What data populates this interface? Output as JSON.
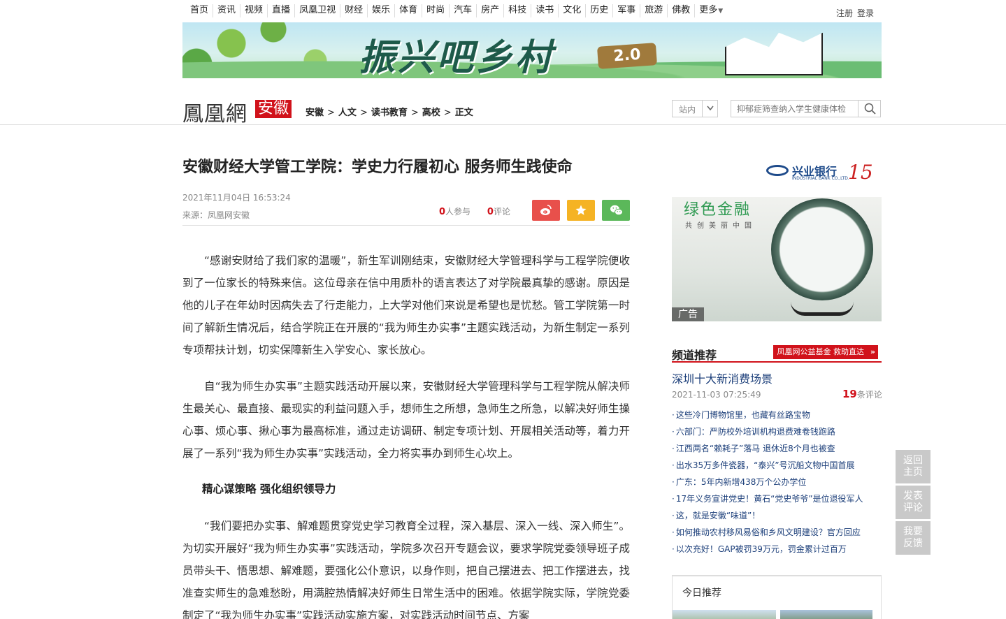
{
  "topnav": {
    "items": [
      "首页",
      "资讯",
      "视频",
      "直播",
      "凤凰卫视",
      "财经",
      "娱乐",
      "体育",
      "时尚",
      "汽车",
      "房产",
      "科技",
      "读书",
      "文化",
      "历史",
      "军事",
      "旅游",
      "佛教",
      "更多"
    ],
    "register": "注册",
    "login": "登录"
  },
  "banner": {
    "title": "振兴吧乡村",
    "version": "2.0"
  },
  "header": {
    "logo": "鳳凰網",
    "region": "安徽",
    "breadcrumb": [
      "安徽",
      "人文",
      "读书教育",
      "高校",
      "正文"
    ],
    "breadcrumb_sep": ">",
    "site_select": "站内",
    "search_placeholder": "抑郁症筛查纳入学生健康体检"
  },
  "article": {
    "title": "安徽财经大学管工学院：学史力行履初心 服务师生践使命",
    "datetime": "2021年11月04日 16:53:24",
    "source": "来源：凤凰网安徽",
    "participants_num": "0",
    "participants_label": "人参与",
    "comments_num": "0",
    "comments_label": "评论",
    "paragraphs": [
      "“感谢安财给了我们家的温暖”，新生军训刚结束，安徽财经大学管理科学与工程学院便收到了一位家长的特殊来信。这位母亲在信中用质朴的语言表达了对学院最真挚的感谢。原因是他的儿子在年幼时因病失去了行走能力，上大学对他们来说是希望也是忧愁。管工学院第一时间了解新生情况后，结合学院正在开展的“我为师生办实事”主题实践活动，为新生制定一系列专项帮扶计划，切实保障新生入学安心、家长放心。",
      "自“我为师生办实事”主题实践活动开展以来，安徽财经大学管理科学与工程学院从解决师生最关心、最直接、最现实的利益问题入手，想师生之所想，急师生之所急，以解决好师生操心事、烦心事、揪心事为最高标准，通过走访调研、制定专项计划、开展相关活动等，着力开展了一系列“我为师生办实事”实践活动，全力将实事办到师生心坎上。",
      "“我们要把办实事、解难题贯穿党史学习教育全过程，深入基层、深入一线、深入师生”。为切实开展好“我为师生办实事”实践活动，学院多次召开专题会议，要求学院党委领导班子成员带头干、悟思想、解难题，要强化公仆意识，以身作则，把自己摆进去、把工作摆进去，找准查实师生的急难愁盼，用满腔热情解决好师生日常生活中的困难。依据学院实际，学院党委制定了“我为师生办实事”实践活动实施方案，对实践活动时间节点、方案"
    ],
    "subheading": "精心谋策略 强化组织领导力"
  },
  "ad": {
    "bank_name": "兴业银行",
    "bank_sub": "INDUSTRIAL BANK CO.,LTD.",
    "anniversary": "15",
    "slogan": "绿色金融",
    "slogan_sub": "共创美丽中国",
    "tag": "广告"
  },
  "sidebar": {
    "channel_title": "频道推荐",
    "channel_link": "凤凰网公益基金  救助直达",
    "featured_title": "深圳十大新消费场景",
    "featured_date": "2021-11-03 07:25:49",
    "featured_comments_num": "19",
    "featured_comments_label": "条评论",
    "news": [
      "这些冷门博物馆里，也藏有丝路宝物",
      "六部门：严防校外培训机构退费难卷钱跑路",
      "江西两名“赖耗子”落马 退休近8个月也被查",
      "出水35万多件瓷器，“泰兴”号沉船文物中国首展",
      "广东：5年内新增438万个公办学位",
      "17年义务宣讲党史！黄石“党史爷爷”是位退役军人",
      "这，就是安徽“味道”！",
      "如何推动农村移风易俗和乡风文明建设？官方回应",
      "以次充好！GAP被罚39万元，罚金累计过百万"
    ],
    "today_title": "今日推荐"
  },
  "float_buttons": [
    {
      "line1": "返回",
      "line2": "主页"
    },
    {
      "line1": "发表",
      "line2": "评论"
    },
    {
      "line1": "我要",
      "line2": "反馈"
    }
  ]
}
